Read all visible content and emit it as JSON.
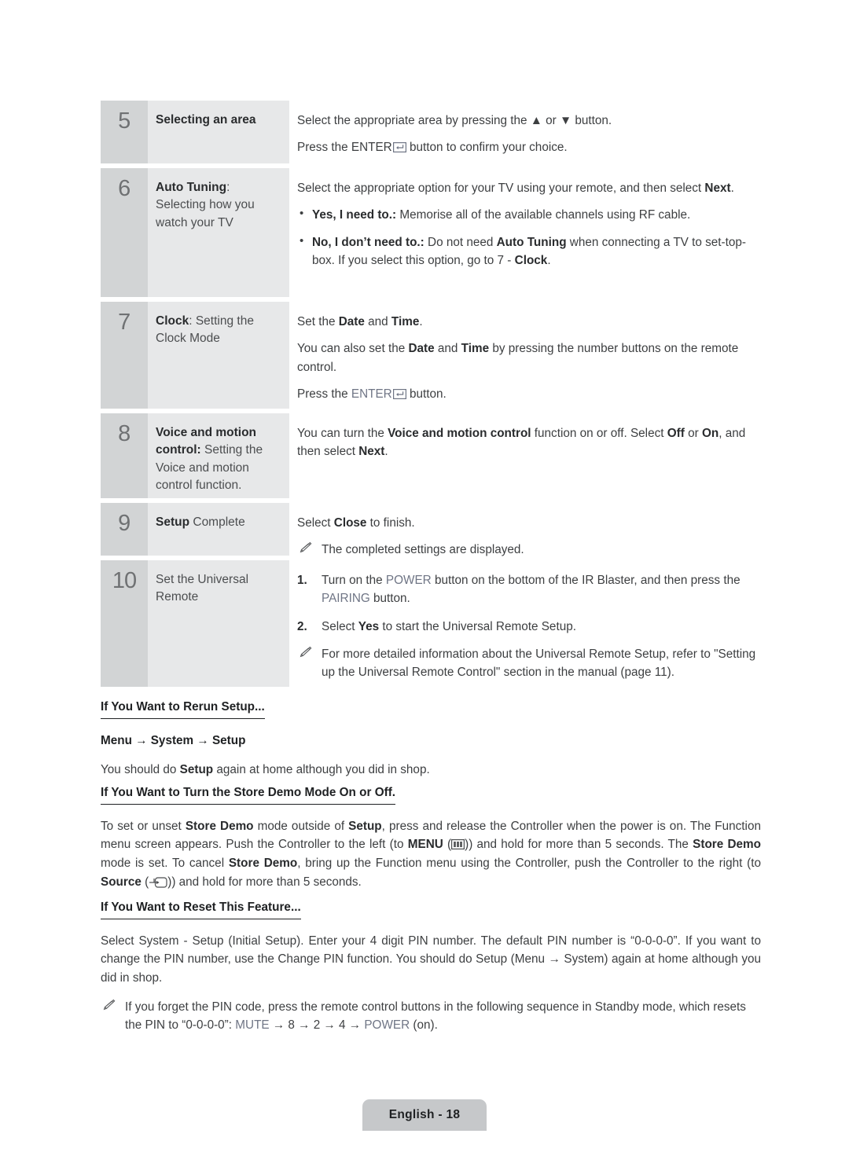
{
  "document": {
    "footer_label": "English - 18"
  },
  "steps": [
    {
      "number": "5",
      "title_bold": "Selecting an area",
      "title_rest": "",
      "lines": [
        "Select the appropriate area by pressing the ▲ or ▼ button.",
        "Press the ENTER",
        " button to confirm your choice."
      ]
    },
    {
      "number": "6",
      "title_bold": "Auto Tuning",
      "title_rest": ": Selecting how you watch your TV",
      "intro_a": "Select the appropriate option for your TV using your remote, and then select ",
      "intro_b": "Next",
      "intro_c": ".",
      "bullets": [
        {
          "bold": "Yes, I need to.:",
          "text": " Memorise all of the available channels using RF cable."
        },
        {
          "bold": "No, I don’t need to.:",
          "text_1": " Do not need ",
          "bold_2": "Auto Tuning",
          "text_2": " when connecting a TV to set-top-box. If you select this option, go to 7 - ",
          "bold_3": "Clock",
          "text_3": "."
        }
      ]
    },
    {
      "number": "7",
      "title_bold": "Clock",
      "title_rest": ": Setting the Clock Mode",
      "p1_a": "Set the ",
      "p1_b": "Date",
      "p1_c": " and ",
      "p1_d": "Time",
      "p1_e": ".",
      "p2_a": "You can also set the ",
      "p2_b": "Date",
      "p2_c": " and ",
      "p2_d": "Time",
      "p2_e": " by pressing the number buttons on the remote control.",
      "p3_a": "Press the ",
      "p3_key": "ENTER",
      "p3_b": " button."
    },
    {
      "number": "8",
      "title_bold": "Voice and motion control:",
      "title_rest": " Setting the Voice and motion control function.",
      "p_a": "You can turn the ",
      "p_b": "Voice and motion control",
      "p_c": " function on or off. Select ",
      "p_d": "Off",
      "p_e": " or ",
      "p_f": "On",
      "p_g": ", and then select ",
      "p_h": "Next",
      "p_i": "."
    },
    {
      "number": "9",
      "title_bold": "Setup",
      "title_rest": " Complete",
      "p_a": "Select ",
      "p_b": "Close",
      "p_c": " to finish.",
      "note": "The completed settings are displayed."
    },
    {
      "number": "10",
      "title_bold": "",
      "title_rest": "Set the Universal Remote",
      "items": [
        {
          "label": "1.",
          "a": "Turn on the ",
          "key1": "POWER",
          "b": " button on the bottom of the IR Blaster, and then press the ",
          "key2": "PAIRING",
          "c": " button."
        },
        {
          "label": "2.",
          "a": "Select ",
          "bold": "Yes",
          "b": " to start the Universal Remote Setup."
        }
      ],
      "note": "For more detailed information about the Universal Remote Setup, refer to \"Setting up the Universal Remote Control\" section in the manual (page 11)."
    }
  ],
  "sections": {
    "rerun": {
      "heading": "If You Want to Rerun Setup...",
      "path": "Menu → System → Setup",
      "body_a": "You should do ",
      "body_b": "Setup",
      "body_c": " again at home although you did in shop."
    },
    "store_demo": {
      "heading": "If You Want to Turn the Store Demo Mode On or Off.",
      "t1": "To set or unset ",
      "b1": "Store Demo",
      "t2": " mode outside of ",
      "b2": "Setup",
      "t3": ", press and release the Controller when the power is on. The Function menu screen appears. Push the Controller to the left (to ",
      "b3": "MENU",
      "t4": " (",
      "t5": ")) and hold for more than 5 seconds. The ",
      "b4": "Store Demo",
      "t6": " mode is set. To cancel ",
      "b5": "Store Demo",
      "t7": ", bring up the Function menu using the Controller, push the Controller to the right (to ",
      "b6": "Source",
      "t8": " (",
      "t9": ")) and hold for more than 5 seconds."
    },
    "reset": {
      "heading": "If You Want to Reset This Feature...",
      "body": "Select System - Setup (Initial Setup). Enter your 4 digit PIN number. The default PIN number is “0-0-0-0”. If you want to change the PIN number, use the Change PIN function. You should do Setup (Menu → System) again at home although you did in shop.",
      "note_a": "If you forget the PIN code, press the remote control buttons in the following sequence in Standby mode, which resets the PIN to “0-0-0-0”: ",
      "note_key1": "MUTE",
      "note_b": " → 8 → 2 → 4 → ",
      "note_key2": "POWER",
      "note_c": " (on)."
    }
  }
}
